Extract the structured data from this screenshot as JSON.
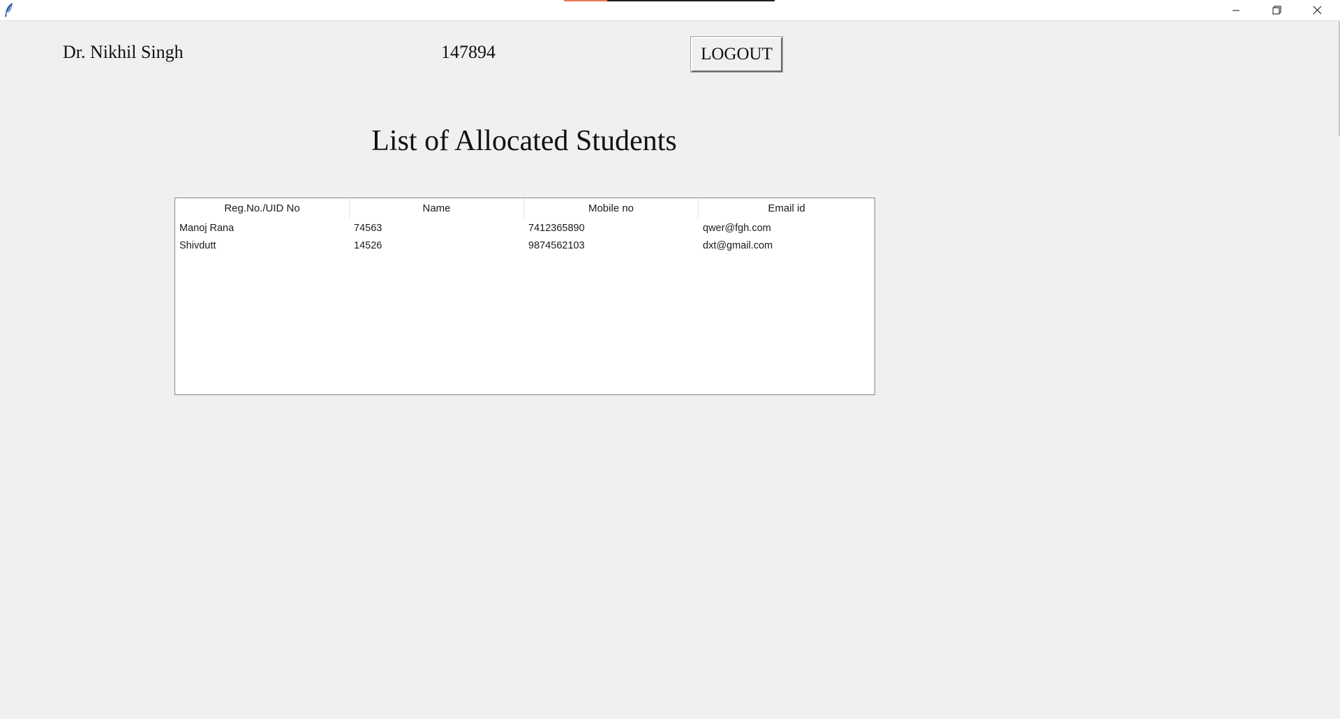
{
  "window": {
    "title": "",
    "controls": {
      "minimize_icon": "minimize-icon",
      "maximize_icon": "restore-icon",
      "close_icon": "close-icon"
    }
  },
  "header": {
    "doctor_name": "Dr. Nikhil Singh",
    "doctor_id": "147894",
    "logout_label": "LOGOUT"
  },
  "main": {
    "title": "List of Allocated Students",
    "table": {
      "columns": [
        "Reg.No./UID No",
        "Name",
        "Mobile no",
        "Email id"
      ],
      "rows": [
        [
          "Manoj Rana",
          "74563",
          "7412365890",
          "qwer@fgh.com"
        ],
        [
          "Shivdutt",
          "14526",
          "9874562103",
          "dxt@gmail.com"
        ]
      ]
    }
  },
  "colors": {
    "background": "#f0f0f0",
    "table_background": "#ffffff",
    "titlebar_accent": "#e8785a"
  }
}
